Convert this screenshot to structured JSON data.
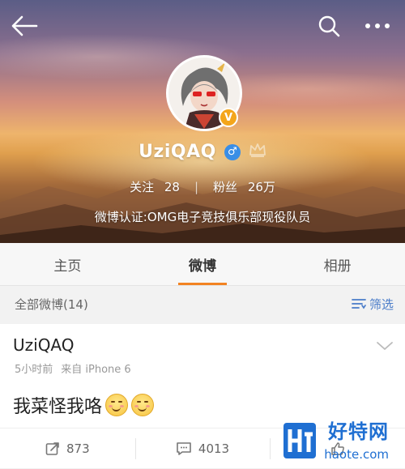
{
  "header": {
    "back_icon": "arrow-left-icon",
    "search_icon": "search-icon",
    "more_icon": "more-dots-icon"
  },
  "profile": {
    "username": "UziQAQ",
    "verified_badge": "V",
    "gender_icon": "male-icon",
    "gender_symbol": "♂",
    "crown_icon": "crown-icon",
    "follow_label": "关注",
    "follow_count": "28",
    "fans_label": "粉丝",
    "fans_count": "26万",
    "verification": "微博认证:OMG电子竞技俱乐部现役队员"
  },
  "tabs": [
    {
      "label": "主页",
      "active": false
    },
    {
      "label": "微博",
      "active": true
    },
    {
      "label": "相册",
      "active": false
    }
  ],
  "filter": {
    "all_posts": "全部微博(14)",
    "filter_label": "筛选"
  },
  "post": {
    "author": "UziQAQ",
    "time": "5小时前",
    "source": "来自 iPhone 6",
    "text": "我菜怪我咯",
    "emoji_count": 2,
    "repost_count": "873",
    "comment_count": "4013"
  },
  "watermark": {
    "logo_text": "好特网",
    "url": "haote.com"
  },
  "colors": {
    "accent": "#f28322",
    "link_blue": "#4a7cc9",
    "badge_orange": "#f4a61b",
    "male_blue": "#3a8ee6"
  }
}
